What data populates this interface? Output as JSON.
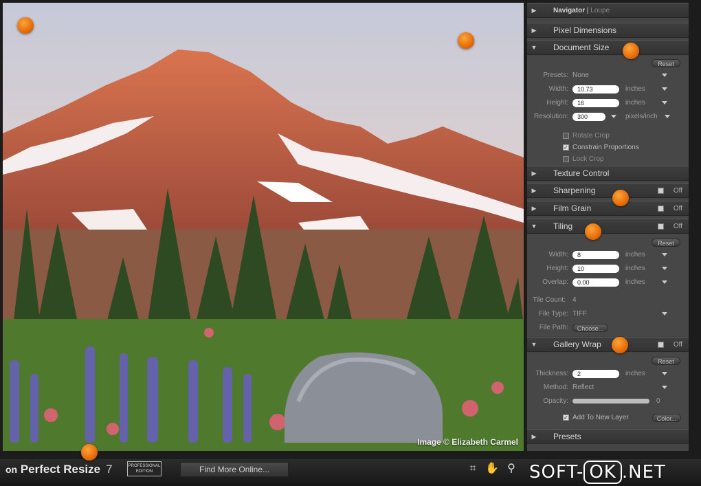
{
  "app": {
    "name": "Perfect Resize",
    "version": "7",
    "edition_badge": "PROFESSIONAL EDITION",
    "find_more": "Find More Online..."
  },
  "image_credit": "Image © Elizabeth Carmel",
  "panel": {
    "navigator": {
      "label": "Navigator",
      "sep": "|",
      "loupe": "Loupe"
    },
    "pixel_dimensions": "Pixel Dimensions",
    "document_size": {
      "label": "Document Size",
      "reset": "Reset",
      "presets_label": "Presets:",
      "presets_value": "None",
      "width_label": "Width:",
      "width_value": "10.73",
      "width_unit": "inches",
      "height_label": "Height:",
      "height_value": "16",
      "height_unit": "inches",
      "resolution_label": "Resolution:",
      "resolution_value": "300",
      "resolution_unit": "pixels/inch",
      "rotate_crop": "Rotate Crop",
      "constrain": "Constrain Proportions",
      "lock_crop": "Lock Crop"
    },
    "texture_control": "Texture Control",
    "sharpening": {
      "label": "Sharpening",
      "state": "Off"
    },
    "film_grain": {
      "label": "Film Grain",
      "state": "Off"
    },
    "tiling": {
      "label": "Tiling",
      "state": "Off",
      "reset": "Reset",
      "width_label": "Width:",
      "width_value": "8",
      "width_unit": "inches",
      "height_label": "Height:",
      "height_value": "10",
      "height_unit": "inches",
      "overlap_label": "Overlap:",
      "overlap_value": "0.00",
      "overlap_unit": "inches",
      "tile_count_label": "Tile Count:",
      "tile_count_value": "4",
      "file_type_label": "File Type:",
      "file_type_value": "TIFF",
      "file_path_label": "File Path:",
      "choose": "Choose..."
    },
    "gallery_wrap": {
      "label": "Gallery Wrap",
      "state": "Off",
      "reset": "Reset",
      "thickness_label": "Thickness:",
      "thickness_value": "2",
      "thickness_unit": "inches",
      "method_label": "Method:",
      "method_value": "Reflect",
      "opacity_label": "Opacity:",
      "opacity_value": "0",
      "add_layer": "Add To New Layer",
      "color": "Color..."
    },
    "presets": "Presets"
  },
  "watermark": {
    "left": "SOFT-",
    "box": "OK",
    "right": ".NET"
  }
}
